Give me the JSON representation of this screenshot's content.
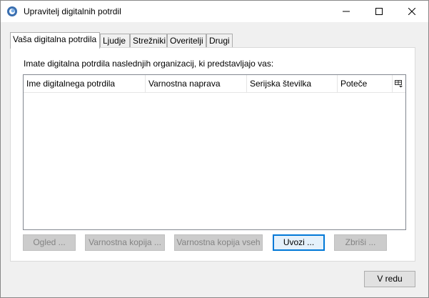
{
  "window": {
    "title": "Upravitelj digitalnih potrdil",
    "controls": {
      "minimize": "minimize",
      "maximize": "maximize",
      "close": "close"
    }
  },
  "tabs": [
    {
      "label": "Vaša digitalna potrdila",
      "active": true
    },
    {
      "label": "Ljudje",
      "active": false
    },
    {
      "label": "Strežniki",
      "active": false
    },
    {
      "label": "Overitelji",
      "active": false
    },
    {
      "label": "Drugi",
      "active": false
    }
  ],
  "panel": {
    "intro": "Imate digitalna potrdila naslednjih organizacij, ki predstavljajo vas:",
    "columns": [
      "Ime digitalnega potrdila",
      "Varnostna naprava",
      "Serijska številka",
      "Poteče"
    ],
    "rows": []
  },
  "buttons": {
    "view": "Ogled ...",
    "backup": "Varnostna kopija ...",
    "backup_all": "Varnostna kopija vseh",
    "import": "Uvozi ...",
    "delete": "Zbriši ..."
  },
  "footer": {
    "ok": "V redu"
  },
  "colors": {
    "accent": "#0078d7",
    "disabled_text": "#838383"
  }
}
